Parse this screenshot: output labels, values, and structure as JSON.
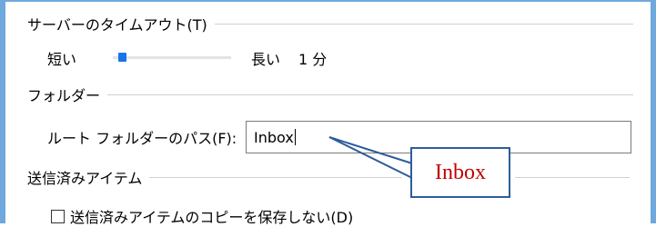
{
  "server_timeout": {
    "title": "サーバーのタイムアウト(T)",
    "short_label": "短い",
    "long_label": "長い",
    "value": "1 分",
    "slider_position": 0.05
  },
  "folders": {
    "title": "フォルダー",
    "root_path_label": "ルート フォルダーのパス(F):",
    "root_path_value": "Inbox"
  },
  "sent_items": {
    "title": "送信済みアイテム",
    "dont_save_copy_label": "送信済みアイテムのコピーを保存しない(D)",
    "checked": false
  },
  "annotation": {
    "callout_text": "Inbox",
    "callout_color": "#c00000",
    "border_color": "#2e5c9a"
  }
}
